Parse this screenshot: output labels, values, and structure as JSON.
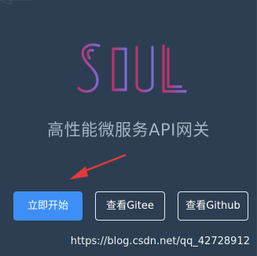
{
  "page": {
    "background": "#2d3e52"
  },
  "hero": {
    "logo_text": "SOUL",
    "logo_gradient": [
      "#b8356d",
      "#7c6ad6"
    ],
    "subtitle": "高性能微服务API网关"
  },
  "annotation": {
    "arrow_color": "#e23a3a",
    "arrow_icon": "red-arrow-icon"
  },
  "actions": {
    "start_label": "立即开始",
    "gitee_label": "查看Gitee",
    "github_label": "查看Github",
    "primary_color": "#3d8ff6"
  },
  "watermark": {
    "text": "https://blog.csdn.net/qq_42728912"
  }
}
